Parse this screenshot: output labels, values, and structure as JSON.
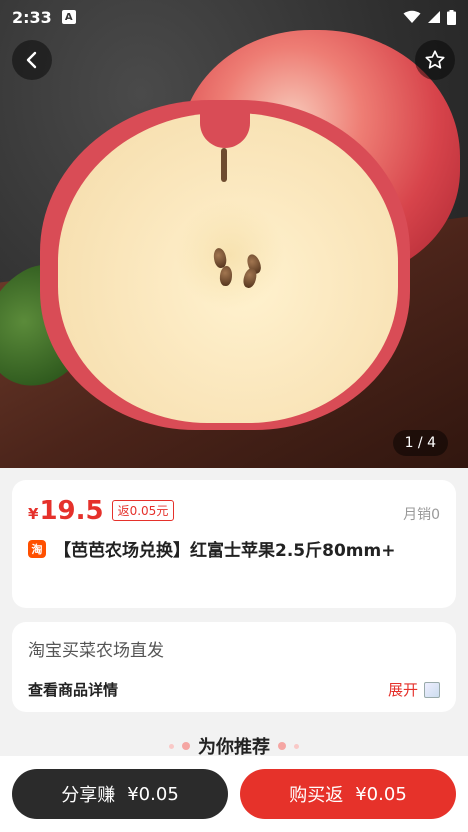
{
  "status_bar": {
    "time": "2:33",
    "badge": "A"
  },
  "gallery": {
    "counter": "1 / 4"
  },
  "product": {
    "currency": "¥",
    "price": "19.5",
    "rebate": "返0.05元",
    "monthly_sales": "月销0",
    "source_badge": "淘",
    "title": "【芭芭农场兑换】红富士苹果2.5斤80mm+"
  },
  "detail": {
    "shop": "淘宝买菜农场直发",
    "label": "查看商品详情",
    "expand": "展开"
  },
  "recommend": {
    "title": "为你推荐"
  },
  "actions": {
    "share_label": "分享赚",
    "share_amount": "¥0.05",
    "buy_label": "购买返",
    "buy_amount": "¥0.05"
  },
  "colors": {
    "accent": "#e5312b",
    "dark_button": "#2b2b2b"
  }
}
